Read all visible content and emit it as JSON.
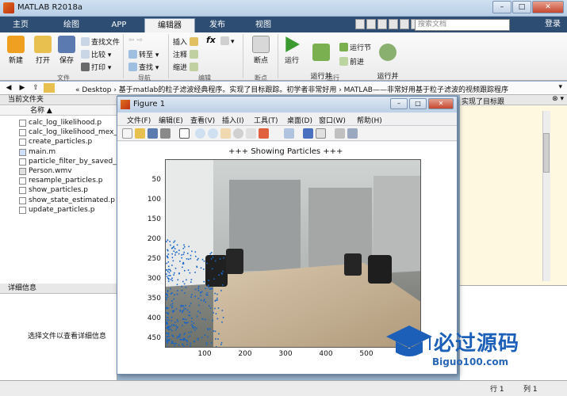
{
  "window": {
    "title": "MATLAB R2018a",
    "controls": [
      "–",
      "□",
      "✕"
    ]
  },
  "tabs": [
    "主页",
    "绘图",
    "APP",
    "编辑器",
    "发布",
    "视图"
  ],
  "active_tab": "编辑器",
  "search_placeholder": "搜索文档",
  "login_label": "登录",
  "ribbon": {
    "new": "新建",
    "open": "打开",
    "save": "保存",
    "find_files": "查找文件",
    "compare": "比较",
    "print": "打印",
    "goto": "转至",
    "find": "查找",
    "insert": "插入",
    "comment": "注释",
    "indent": "缩进",
    "fx": "fx",
    "breakpoints": "断点",
    "run": "运行",
    "run_advance": "运行并\n前进",
    "run_section": "运行节",
    "advance": "前进",
    "run_time": "运行并\n计时",
    "groups": {
      "file": "文件",
      "navigate": "导航",
      "edit": "编辑",
      "breakpoints": "断点",
      "run": "运行"
    }
  },
  "address": {
    "path": "« Desktop › 基于matlab的粒子滤波经典程序。实现了目标跟踪。初学者非常好用 › MATLAB——非常好用基于粒子滤波的视频跟踪程序"
  },
  "left_panel": {
    "title": "当前文件夹",
    "column_name": "名称 ▲",
    "files": [
      "calc_log_likelihood.p",
      "calc_log_likelihood_mex_h",
      "create_particles.p",
      "main.m",
      "particle_filter_by_saved_m",
      "Person.wmv",
      "resample_particles.p",
      "show_particles.p",
      "show_state_estimated.p",
      "update_particles.p"
    ],
    "details_title": "详细信息",
    "details_text": "选择文件以查看详细信息"
  },
  "editor_snippet": "实现了目标跟",
  "figure": {
    "title": "Figure 1",
    "menu": [
      "文件(F)",
      "编辑(E)",
      "查看(V)",
      "插入(I)",
      "工具(T)",
      "桌面(D)",
      "窗口(W)",
      "帮助(H)"
    ],
    "plot_title": "+++ Showing Particles +++",
    "y_ticks": [
      "50",
      "100",
      "150",
      "200",
      "250",
      "300",
      "350",
      "400",
      "450"
    ],
    "x_ticks": [
      "100",
      "200",
      "300",
      "400",
      "500"
    ]
  },
  "status": {
    "row_label": "行",
    "row_value": "1",
    "col_label": "列",
    "col_value": "1"
  },
  "watermark": {
    "text": "必过源码",
    "url": "Biguo100.com"
  },
  "colors": {
    "tabbar": "#2d4d72",
    "particles": "#1565c8",
    "watermark": "#1b5fb8"
  }
}
